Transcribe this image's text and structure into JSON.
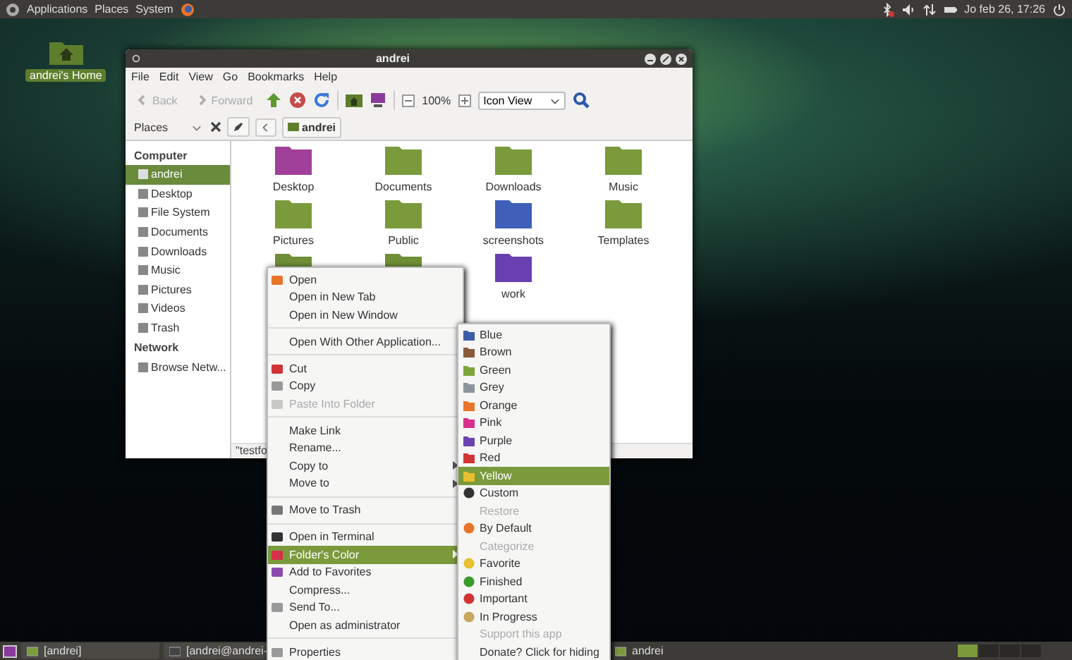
{
  "top_panel": {
    "menus": [
      "Applications",
      "Places",
      "System"
    ],
    "clock": "Jo feb 26, 17:26"
  },
  "desktop_icons": [
    {
      "label": "andrei's Home"
    }
  ],
  "window": {
    "title": "andrei",
    "menu": [
      "File",
      "Edit",
      "View",
      "Go",
      "Bookmarks",
      "Help"
    ],
    "toolbar": {
      "back": {
        "label": "Back",
        "disabled": true
      },
      "forward": {
        "label": "Forward",
        "disabled": true
      },
      "zoom": "100%",
      "view": "Icon View"
    },
    "location": {
      "pane": "Places",
      "path": "andrei"
    },
    "sidebar": [
      {
        "heading": "Computer",
        "items": [
          {
            "label": "andrei",
            "selected": true
          },
          {
            "label": "Desktop",
            "selected": false
          },
          {
            "label": "File System",
            "selected": false
          },
          {
            "label": "Documents",
            "selected": false
          },
          {
            "label": "Downloads",
            "selected": false
          },
          {
            "label": "Music",
            "selected": false
          },
          {
            "label": "Pictures",
            "selected": false
          },
          {
            "label": "Videos",
            "selected": false
          },
          {
            "label": "Trash",
            "selected": false
          }
        ]
      },
      {
        "heading": "Network",
        "items": [
          {
            "label": "Browse Netw...",
            "selected": false
          }
        ]
      }
    ],
    "files": [
      {
        "label": "Desktop",
        "color": "#a0409a"
      },
      {
        "label": "Documents",
        "color": "#7a9a3c"
      },
      {
        "label": "Downloads",
        "color": "#7a9a3c"
      },
      {
        "label": "Music",
        "color": "#7a9a3c"
      },
      {
        "label": "Pictures",
        "color": "#7a9a3c"
      },
      {
        "label": "Public",
        "color": "#7a9a3c"
      },
      {
        "label": "screenshots",
        "color": "#3f5fb8"
      },
      {
        "label": "Templates",
        "color": "#7a9a3c"
      },
      {
        "color": "#6f8f36"
      },
      {
        "color": "#6f8f36"
      },
      {
        "label": "work",
        "color": "#6a3fb0"
      }
    ],
    "status": "\"testfo"
  },
  "context_menu": [
    {
      "kind": "icon-item",
      "label": "Open",
      "disabled": false,
      "selected": false,
      "submenu": false
    },
    {
      "kind": "item",
      "label": "Open in New Tab",
      "disabled": false,
      "selected": false,
      "submenu": false
    },
    {
      "kind": "item",
      "label": "Open in New Window",
      "disabled": false,
      "selected": false,
      "submenu": false
    },
    {
      "kind": "separator"
    },
    {
      "kind": "item",
      "label": "Open With Other Application...",
      "disabled": false,
      "selected": false,
      "submenu": false
    },
    {
      "kind": "separator"
    },
    {
      "kind": "icon-item",
      "label": "Cut",
      "disabled": false,
      "selected": false,
      "submenu": false
    },
    {
      "kind": "icon-item",
      "label": "Copy",
      "disabled": false,
      "selected": false,
      "submenu": false
    },
    {
      "kind": "icon-item",
      "label": "Paste Into Folder",
      "disabled": true,
      "selected": false,
      "submenu": false
    },
    {
      "kind": "separator"
    },
    {
      "kind": "item",
      "label": "Make Link",
      "disabled": false,
      "selected": false,
      "submenu": false
    },
    {
      "kind": "item",
      "label": "Rename...",
      "disabled": false,
      "selected": false,
      "submenu": false
    },
    {
      "kind": "item",
      "label": "Copy to",
      "disabled": false,
      "selected": false,
      "submenu": true
    },
    {
      "kind": "item",
      "label": "Move to",
      "disabled": false,
      "selected": false,
      "submenu": true
    },
    {
      "kind": "separator"
    },
    {
      "kind": "icon-item",
      "label": "Move to Trash",
      "disabled": false,
      "selected": false,
      "submenu": false
    },
    {
      "kind": "separator"
    },
    {
      "kind": "icon-item",
      "label": "Open in Terminal",
      "disabled": false,
      "selected": false,
      "submenu": false
    },
    {
      "kind": "icon-item",
      "label": "Folder's Color",
      "disabled": false,
      "selected": true,
      "submenu": true
    },
    {
      "kind": "icon-item",
      "label": "Add to Favorites",
      "disabled": false,
      "selected": false,
      "submenu": false
    },
    {
      "kind": "item",
      "label": "Compress...",
      "disabled": false,
      "selected": false,
      "submenu": false
    },
    {
      "kind": "icon-item",
      "label": "Send To...",
      "disabled": false,
      "selected": false,
      "submenu": false
    },
    {
      "kind": "item",
      "label": "Open as administrator",
      "disabled": false,
      "selected": false,
      "submenu": false
    },
    {
      "kind": "separator"
    },
    {
      "kind": "icon-item",
      "label": "Properties",
      "disabled": false,
      "selected": false,
      "submenu": false
    }
  ],
  "color_submenu": [
    {
      "kind": "color",
      "label": "Blue",
      "color": "#3b5ea8",
      "selected": false,
      "disabled": false
    },
    {
      "kind": "color",
      "label": "Brown",
      "color": "#8a5a3c",
      "selected": false,
      "disabled": false
    },
    {
      "kind": "color",
      "label": "Green",
      "color": "#7da53a",
      "selected": false,
      "disabled": false
    },
    {
      "kind": "color",
      "label": "Grey",
      "color": "#8c949c",
      "selected": false,
      "disabled": false
    },
    {
      "kind": "color",
      "label": "Orange",
      "color": "#e8742a",
      "selected": false,
      "disabled": false
    },
    {
      "kind": "color",
      "label": "Pink",
      "color": "#d8308c",
      "selected": false,
      "disabled": false
    },
    {
      "kind": "color",
      "label": "Purple",
      "color": "#6a44b0",
      "selected": false,
      "disabled": false
    },
    {
      "kind": "color",
      "label": "Red",
      "color": "#d03434",
      "selected": false,
      "disabled": false
    },
    {
      "kind": "color",
      "label": "Yellow",
      "color": "#e8c030",
      "selected": true,
      "disabled": false
    },
    {
      "kind": "icon",
      "label": "Custom",
      "selected": false,
      "disabled": false
    },
    {
      "kind": "text",
      "label": "Restore",
      "selected": false,
      "disabled": true
    },
    {
      "kind": "icon",
      "label": "By Default",
      "selected": false,
      "disabled": false
    },
    {
      "kind": "text",
      "label": "Categorize",
      "selected": false,
      "disabled": true
    },
    {
      "kind": "icon",
      "label": "Favorite",
      "selected": false,
      "disabled": false
    },
    {
      "kind": "icon",
      "label": "Finished",
      "selected": false,
      "disabled": false
    },
    {
      "kind": "icon",
      "label": "Important",
      "selected": false,
      "disabled": false
    },
    {
      "kind": "icon",
      "label": "In Progress",
      "selected": false,
      "disabled": false
    },
    {
      "kind": "text",
      "label": "Support this app",
      "selected": false,
      "disabled": true
    },
    {
      "kind": "text",
      "label": "Donate? Click for hiding",
      "selected": false,
      "disabled": false
    }
  ],
  "taskbar": [
    {
      "label": "[andrei]"
    },
    {
      "label": "[andrei@andrei-"
    },
    {
      "label": "andrei"
    }
  ],
  "workspaces": [
    {
      "selected": true
    },
    {
      "selected": false
    },
    {
      "selected": false
    },
    {
      "selected": false
    }
  ]
}
